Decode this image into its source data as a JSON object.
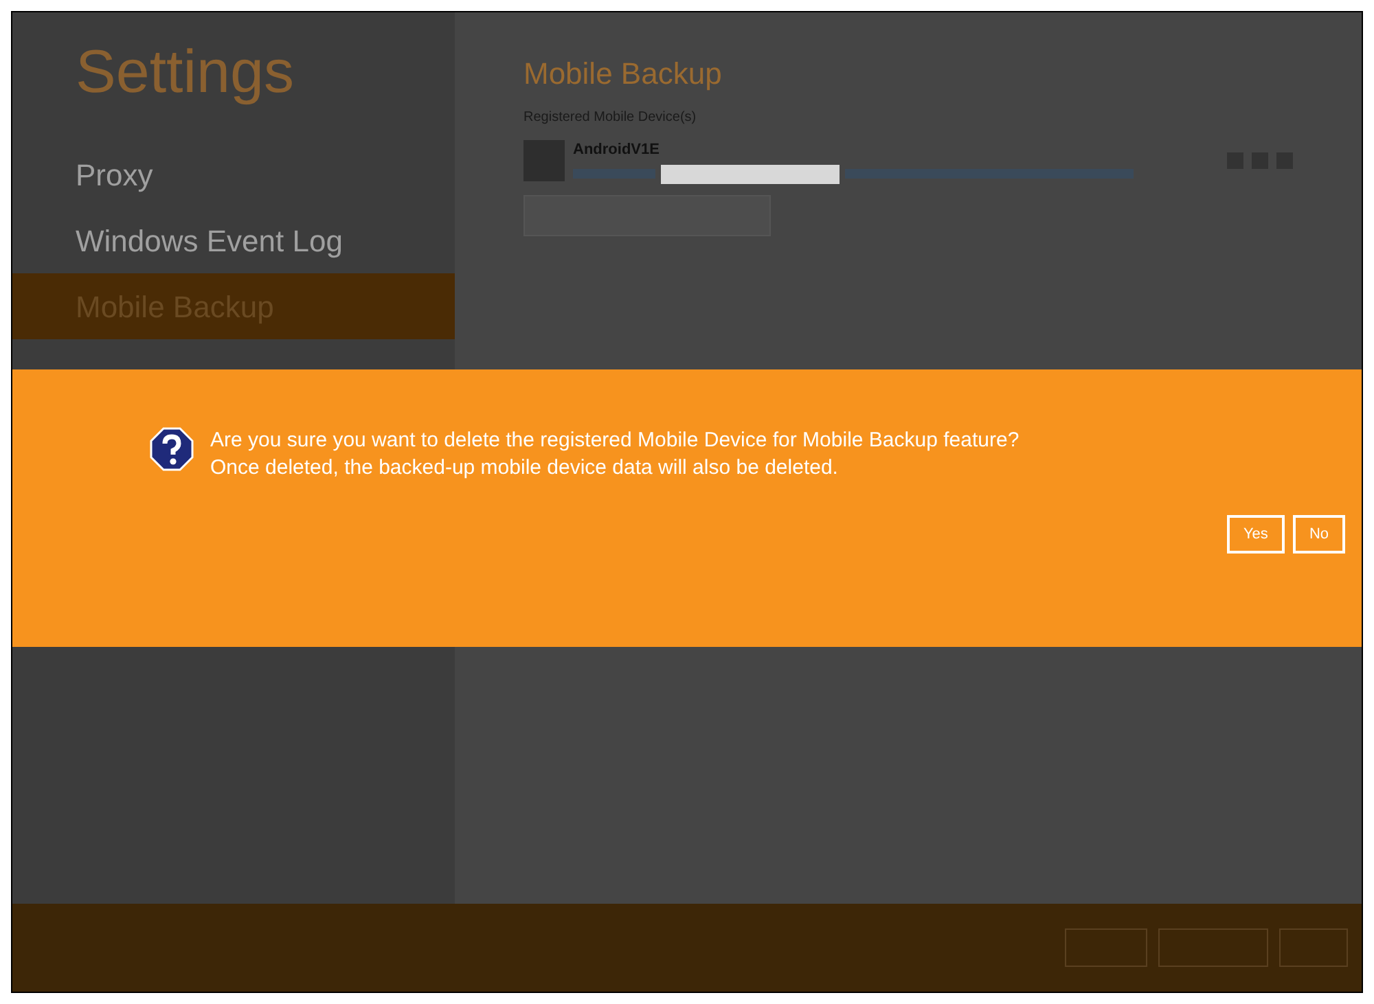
{
  "sidebar": {
    "title": "Settings",
    "items": [
      {
        "label": "Proxy",
        "selected": false
      },
      {
        "label": "Windows Event Log",
        "selected": false
      },
      {
        "label": "Mobile Backup",
        "selected": true
      }
    ]
  },
  "content": {
    "heading": "Mobile Backup",
    "section_label": "Registered Mobile Device(s)",
    "devices": [
      {
        "name": "AndroidV1E"
      }
    ]
  },
  "dialog": {
    "lines": [
      "Are you sure you want to delete the registered Mobile Device for Mobile Backup feature?",
      "Once deleted, the backed-up mobile device data will also be deleted."
    ],
    "buttons": [
      "Yes",
      "No"
    ]
  }
}
